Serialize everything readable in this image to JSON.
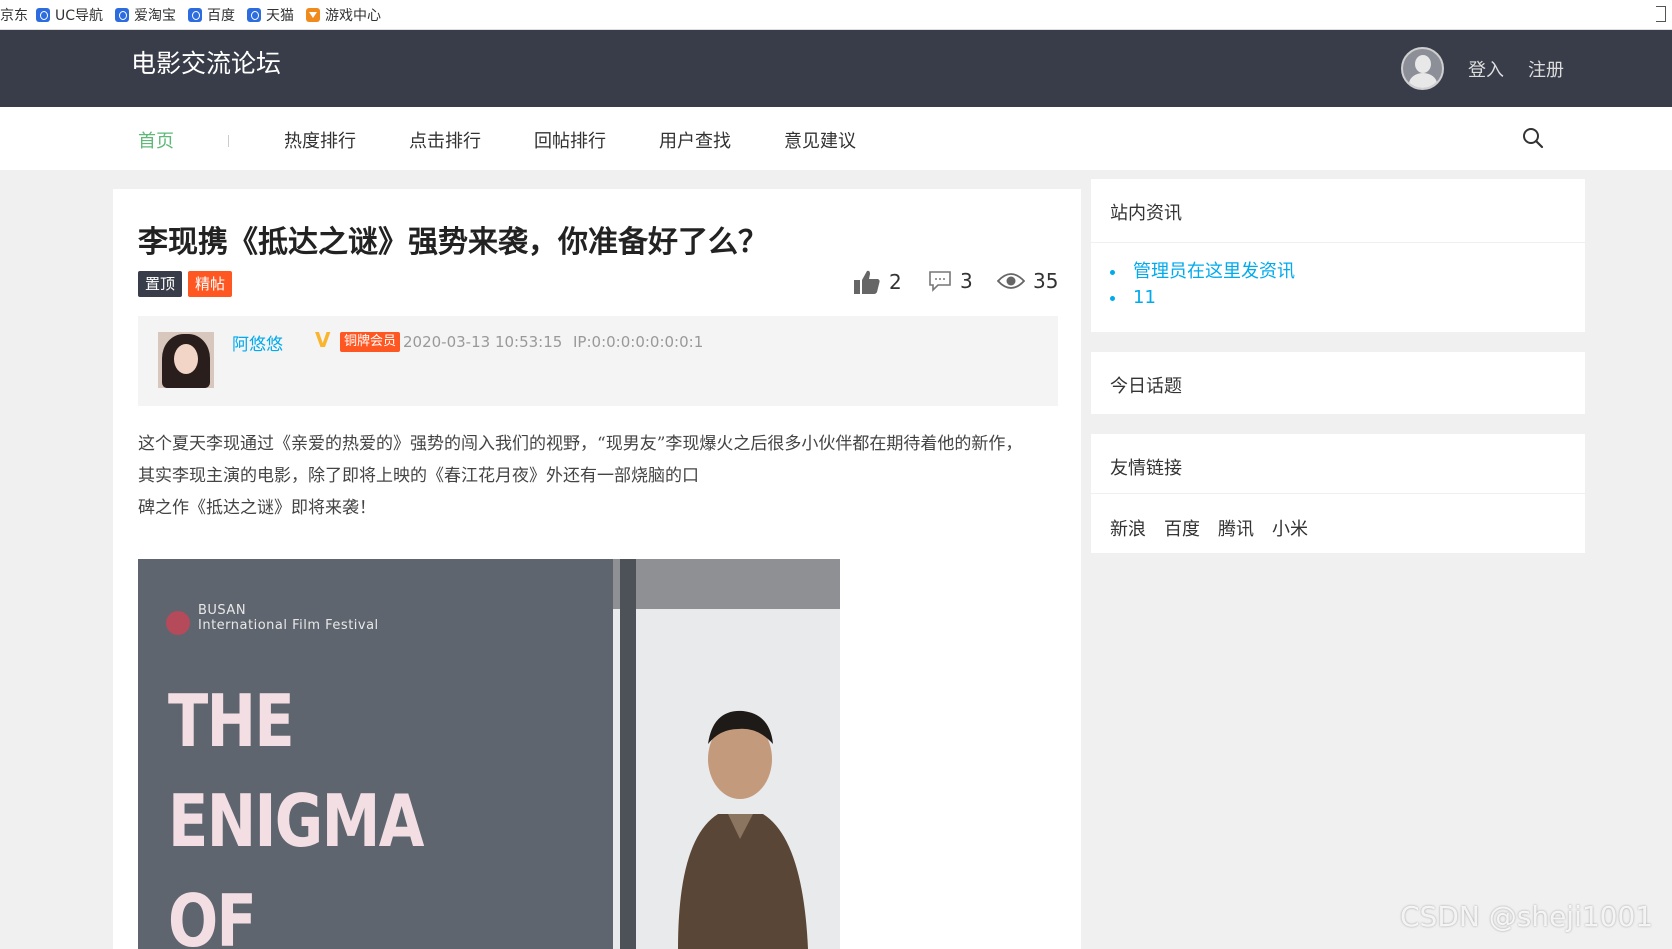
{
  "bookmarks": {
    "first": "京东",
    "items": [
      {
        "label": "UC导航",
        "icon": "browser-icon"
      },
      {
        "label": "爱淘宝",
        "icon": "browser-icon"
      },
      {
        "label": "百度",
        "icon": "browser-icon"
      },
      {
        "label": "天猫",
        "icon": "browser-icon"
      },
      {
        "label": "游戏中心",
        "icon": "game-icon"
      }
    ]
  },
  "header": {
    "site_title": "电影交流论坛",
    "login": "登入",
    "register": "注册",
    "bg_color": "#393d49"
  },
  "nav": {
    "items": [
      {
        "label": "首页",
        "active": true
      },
      {
        "label": "热度排行"
      },
      {
        "label": "点击排行"
      },
      {
        "label": "回帖排行"
      },
      {
        "label": "用户查找"
      },
      {
        "label": "意见建议"
      }
    ],
    "active_color": "#5fb878"
  },
  "post": {
    "title": "李现携《抵达之谜》强势来袭，你准备好了么？",
    "badges": {
      "top": "置顶",
      "good": "精帖"
    },
    "stats": {
      "likes": "2",
      "replies": "3",
      "views": "35"
    },
    "author": {
      "name": "阿悠悠",
      "verified": "V",
      "member_level": "铜牌会员",
      "time": "2020-03-13 10:53:15",
      "ip": "IP:0:0:0:0:0:0:0:1"
    },
    "content_lines": [
      "这个夏天李现通过《亲爱的热爱的》强势的闯入我们的视野，“现男友”李现爆火之后很多小伙伴都在期待着他的新作，",
      "其实李现主演的电影，除了即将上映的《春江花月夜》外还有一部烧脑的口",
      "碑之作《抵达之谜》即将来袭！"
    ],
    "poster": {
      "festival_line1": "BUSAN",
      "festival_line2": "International Film Festival",
      "title_lines": [
        "THE",
        "ENIGMA",
        "OF"
      ]
    }
  },
  "sidebar": {
    "news": {
      "title": "站内资讯",
      "items": [
        "管理员在这里发资讯",
        "11"
      ]
    },
    "today": {
      "title": "今日话题"
    },
    "links": {
      "title": "友情链接",
      "items": [
        "新浪",
        "百度",
        "腾讯",
        "小米"
      ]
    }
  },
  "watermark": "CSDN @sheji1001"
}
